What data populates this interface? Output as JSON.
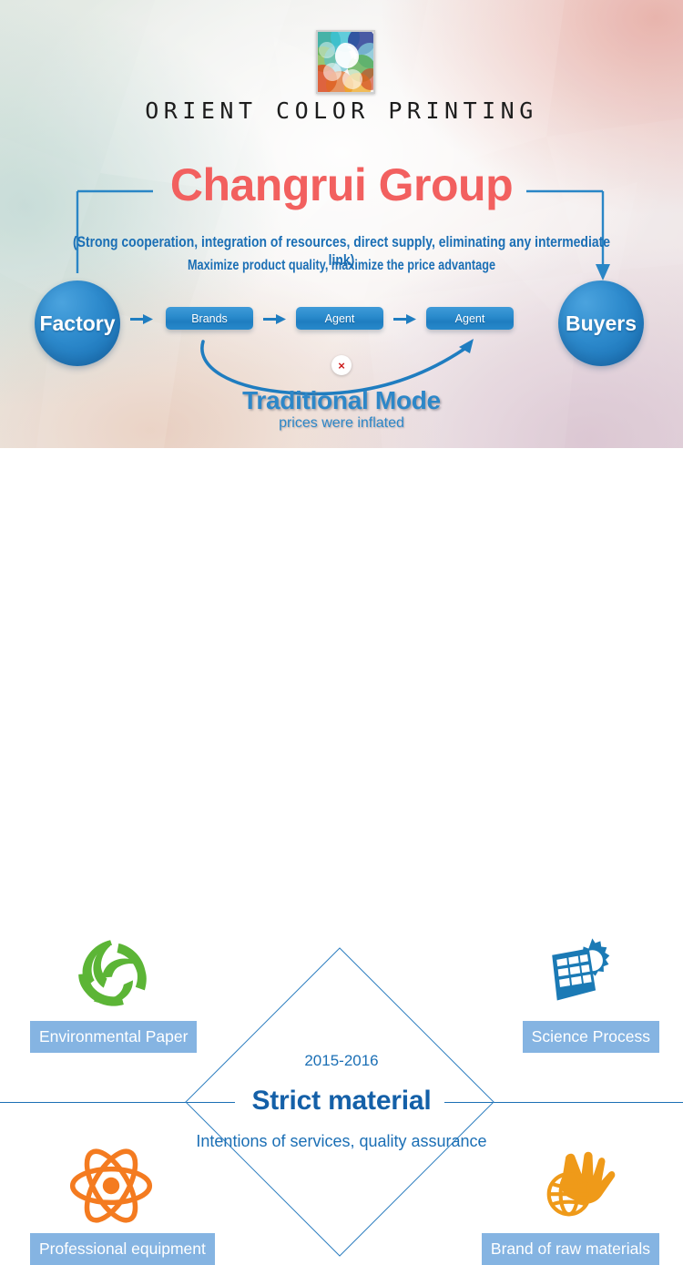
{
  "header": {
    "logo_icon": "orient-color-mosaic-logo",
    "brand_name": "ORIENT COLOR PRINTING"
  },
  "hero": {
    "group_title": "Changrui Group",
    "subtitle_line1": "(Strong cooperation, integration of resources, direct supply, eliminating any intermediate link)",
    "subtitle_line2": "Maximize product quality, maximize the price advantage",
    "accent_red": "#f2605f",
    "accent_blue": "#1b6fb5"
  },
  "flow": {
    "factory_label": "Factory",
    "buyers_label": "Buyers",
    "steps": [
      {
        "label": "Brands"
      },
      {
        "label": "Agent"
      },
      {
        "label": "Agent"
      }
    ],
    "x_marker": "×",
    "traditional_title": "Traditional Mode",
    "traditional_subtitle": "prices were inflated",
    "node_color": "#2e8bcd",
    "pill_color": "#2b8ccd"
  },
  "center": {
    "year_range": "2015-2016",
    "title": "Strict material",
    "tagline": "Intentions of services, quality assurance",
    "line_color": "#1b6fb5"
  },
  "features": [
    {
      "id": "environmental-paper",
      "label": "Environmental Paper",
      "icon": "recycle-leaves-icon",
      "color": "#5cb536"
    },
    {
      "id": "science-process",
      "label": "Science Process",
      "icon": "solar-panel-gear-icon",
      "color": "#1b7ab5"
    },
    {
      "id": "professional-equipment",
      "label": "Professional equipment",
      "icon": "atom-icon",
      "color": "#f47b20"
    },
    {
      "id": "brand-raw-materials",
      "label": "Brand of raw materials",
      "icon": "hand-globe-icon",
      "color": "#ef9a19"
    }
  ],
  "label_chip_color": "#85b4e2"
}
